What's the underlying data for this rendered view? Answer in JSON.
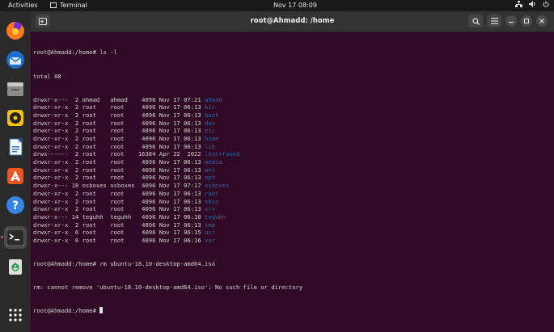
{
  "topbar": {
    "activities": "Activities",
    "app_name": "Terminal",
    "clock": "Nov 17  08:09"
  },
  "window": {
    "title": "root@Ahmadd: /home"
  },
  "terminal": {
    "prompt": "root@Ahmadd:/home#",
    "cmd1": " ls -l",
    "total": "total 88",
    "entries": [
      {
        "meta": "drwxr-x---  2 ahmad   ahmad    4096 Nov 17 07:21 ",
        "name": "ahmad"
      },
      {
        "meta": "drwxr-xr-x  2 root    root     4096 Nov 17 06:13 ",
        "name": "bin"
      },
      {
        "meta": "drwxr-xr-x  2 root    root     4096 Nov 17 06:13 ",
        "name": "boot"
      },
      {
        "meta": "drwxr-xr-x  2 root    root     4096 Nov 17 06:13 ",
        "name": "dev"
      },
      {
        "meta": "drwxr-xr-x  2 root    root     4096 Nov 17 06:13 ",
        "name": "etc"
      },
      {
        "meta": "drwxr-xr-x  2 root    root     4096 Nov 17 06:13 ",
        "name": "home"
      },
      {
        "meta": "drwxr-xr-x  2 root    root     4096 Nov 17 06:13 ",
        "name": "lib"
      },
      {
        "meta": "drwx------  2 root    root    16384 Apr 22  2022 ",
        "name": "lost+found"
      },
      {
        "meta": "drwxr-xr-x  2 root    root     4096 Nov 17 06:13 ",
        "name": "media"
      },
      {
        "meta": "drwxr-xr-x  2 root    root     4096 Nov 17 06:13 ",
        "name": "mnt"
      },
      {
        "meta": "drwxr-xr-x  2 root    root     4096 Nov 17 06:13 ",
        "name": "opt"
      },
      {
        "meta": "drwxr-x--- 18 osboxes osboxes  4096 Nov 17 07:17 ",
        "name": "osboxes"
      },
      {
        "meta": "drwxr-xr-x  2 root    root     4096 Nov 17 06:13 ",
        "name": "root"
      },
      {
        "meta": "drwxr-xr-x  2 root    root     4096 Nov 17 06:13 ",
        "name": "sbin"
      },
      {
        "meta": "drwxr-xr-x  2 root    root     4096 Nov 17 06:13 ",
        "name": "srv"
      },
      {
        "meta": "drwxr-x--- 14 teguhh  teguhh   4096 Nov 17 06:10 ",
        "name": "teguhh"
      },
      {
        "meta": "drwxr-xr-x  2 root    root     4096 Nov 17 06:13 ",
        "name": "tmp"
      },
      {
        "meta": "drwxr-xr-x  6 root    root     4096 Nov 17 06:15 ",
        "name": "usr"
      },
      {
        "meta": "drwxr-xr-x  6 root    root     4096 Nov 17 06:16 ",
        "name": "var"
      }
    ],
    "cmd2": " rm ubuntu-18.10-desktop-amd64.iso",
    "error": "rm: cannot remove 'ubuntu-18.10-desktop-amd64.iso': No such file or directory"
  },
  "dock": [
    "firefox-icon",
    "thunderbird-icon",
    "files-icon",
    "rhythmbox-icon",
    "writer-icon",
    "software-icon",
    "help-icon",
    "terminal-icon",
    "trash-icon",
    "app-grid-icon"
  ],
  "colors": {
    "terminal_bg": "#300a24",
    "directory": "#3465a4",
    "accent": "#e95420"
  }
}
